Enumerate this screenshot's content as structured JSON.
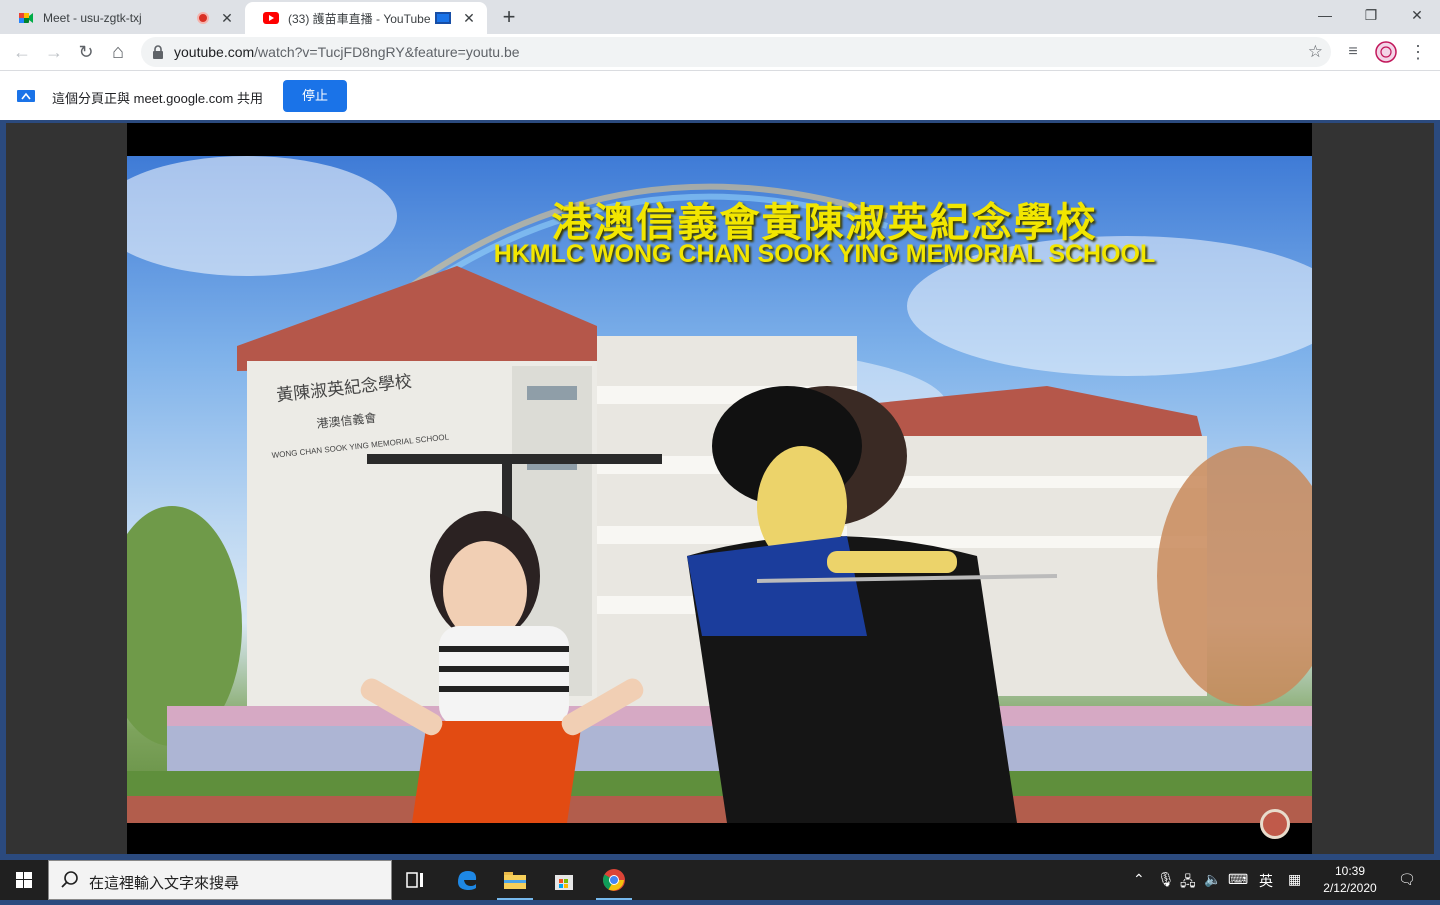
{
  "browser": {
    "tabs": [
      {
        "title": "Meet - usu-zgtk-txj",
        "favicon": "google-meet-icon",
        "recording": true
      },
      {
        "title": "(33) 護苗車直播 - YouTube",
        "favicon": "youtube-icon",
        "casting": true
      }
    ],
    "new_tab": "+",
    "window_controls": {
      "minimize": "—",
      "restore": "❐",
      "close": "✕"
    },
    "nav": {
      "back": "←",
      "forward": "→",
      "reload": "↻",
      "home": "⌂"
    },
    "url_host": "youtube.com",
    "url_path": "/watch?v=TucjFD8ngRY&feature=youtu.be",
    "star": "☆",
    "menu": "⋮",
    "media": "≡"
  },
  "share_bar": {
    "message": "這個分頁正與 meet.google.com 共用",
    "stop_label": "停止"
  },
  "video": {
    "title_zh": "港澳信義會黃陳淑英紀念學校",
    "title_en": "HKMLC WONG CHAN SOOK YING MEMORIAL SCHOOL",
    "building_sign_zh": "黃陳淑英紀念學校",
    "building_sign_sub": "港澳信義會",
    "building_sign_en": "WONG CHAN SOOK YING MEMORIAL SCHOOL"
  },
  "taskbar": {
    "search_placeholder": "在這裡輸入文字來搜尋",
    "ime": "英",
    "time": "10:39",
    "date": "2/12/2020"
  },
  "colors": {
    "tabstrip": "#dee1e6",
    "accent": "#1a73e8",
    "title_yellow": "#f2e600",
    "taskbar": "#202020"
  }
}
